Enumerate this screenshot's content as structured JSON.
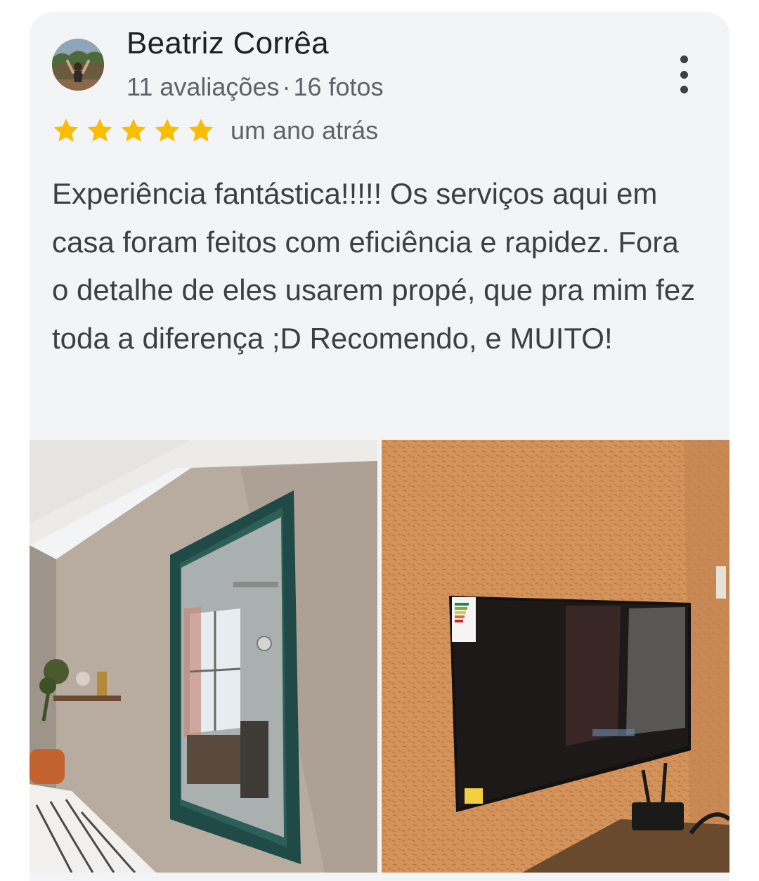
{
  "review": {
    "reviewer_name": "Beatriz Corrêa",
    "reviews_count": "11 avaliações",
    "separator": "·",
    "photos_count": "16 fotos",
    "rating": 5,
    "date": "um ano atrás",
    "text": "Experiência fantástica!!!!! Os serviços aqui em casa foram feitos com eficiência e rapidez. Fora o detalhe de eles usarem propé, que pra mim fez toda a diferença ;D Recomendo, e MUITO!"
  },
  "icons": {
    "menu": "more-vertical-icon",
    "star": "star-icon"
  },
  "colors": {
    "star": "#fbbc04",
    "card_background": "#f3f4f6",
    "name_text": "#202124",
    "meta_text": "#5f6368",
    "body_text": "#3c4043"
  },
  "photos": [
    {
      "subject": "mirror-photo"
    },
    {
      "subject": "tv-photo"
    }
  ]
}
